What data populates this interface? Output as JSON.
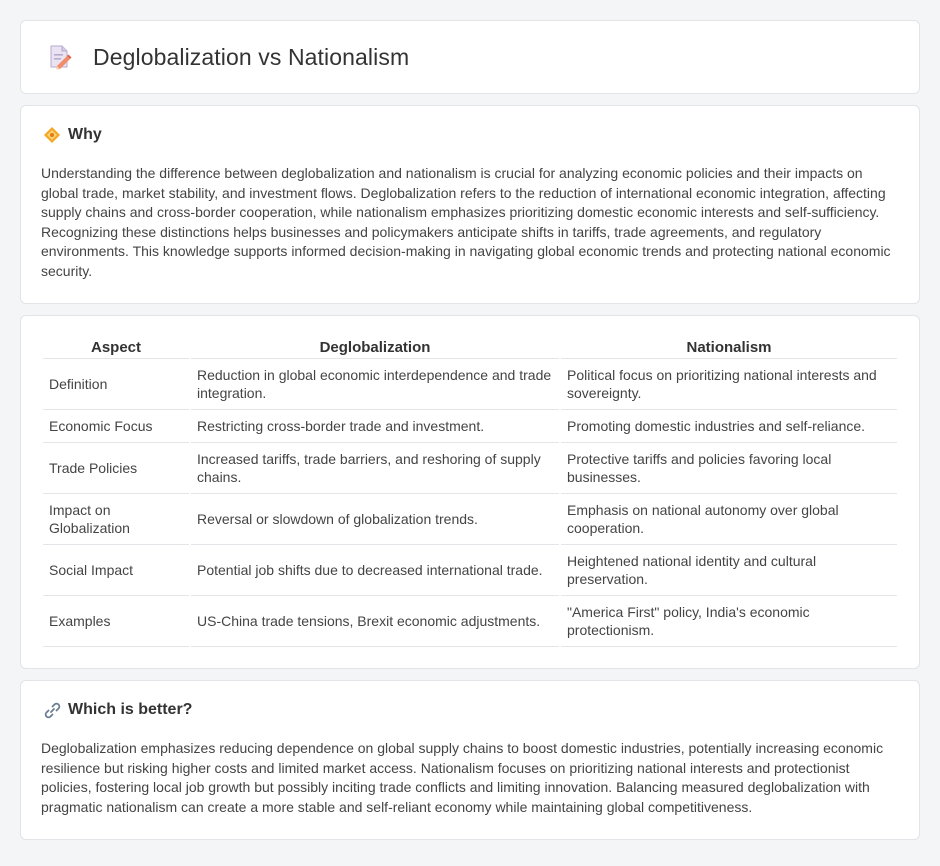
{
  "header": {
    "title": "Deglobalization vs Nationalism",
    "icon": "document-pencil-icon"
  },
  "why": {
    "heading": "Why",
    "icon": "diamond-icon",
    "text": "Understanding the difference between deglobalization and nationalism is crucial for analyzing economic policies and their impacts on global trade, market stability, and investment flows. Deglobalization refers to the reduction of international economic integration, affecting supply chains and cross-border cooperation, while nationalism emphasizes prioritizing domestic economic interests and self-sufficiency. Recognizing these distinctions helps businesses and policymakers anticipate shifts in tariffs, trade agreements, and regulatory environments. This knowledge supports informed decision-making in navigating global economic trends and protecting national economic security."
  },
  "table": {
    "headers": [
      "Aspect",
      "Deglobalization",
      "Nationalism"
    ],
    "rows": [
      [
        "Definition",
        "Reduction in global economic interdependence and trade integration.",
        "Political focus on prioritizing national interests and sovereignty."
      ],
      [
        "Economic Focus",
        "Restricting cross-border trade and investment.",
        "Promoting domestic industries and self-reliance."
      ],
      [
        "Trade Policies",
        "Increased tariffs, trade barriers, and reshoring of supply chains.",
        "Protective tariffs and policies favoring local businesses."
      ],
      [
        "Impact on Globalization",
        "Reversal or slowdown of globalization trends.",
        "Emphasis on national autonomy over global cooperation."
      ],
      [
        "Social Impact",
        "Potential job shifts due to decreased international trade.",
        "Heightened national identity and cultural preservation."
      ],
      [
        "Examples",
        "US-China trade tensions, Brexit economic adjustments.",
        "\"America First\" policy, India's economic protectionism."
      ]
    ]
  },
  "which": {
    "heading": "Which is better?",
    "icon": "link-icon",
    "text": "Deglobalization emphasizes reducing dependence on global supply chains to boost domestic industries, potentially increasing economic resilience but risking higher costs and limited market access. Nationalism focuses on prioritizing national interests and protectionist policies, fostering local job growth but possibly inciting trade conflicts and limiting innovation. Balancing measured deglobalization with pragmatic nationalism can create a more stable and self-reliant economy while maintaining global competitiveness."
  }
}
